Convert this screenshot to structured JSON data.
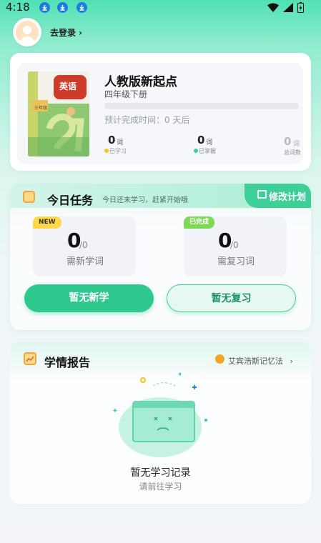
{
  "status_bar": {
    "time": "4:18"
  },
  "header": {
    "login_label": "去登录 ›"
  },
  "book": {
    "cover_text": "英语",
    "cover_grade": "三年级",
    "title": "人教版新起点",
    "grade": "四年级下册",
    "progress_fraction": 0,
    "eta": "预计完成时间：0 天后",
    "stats": [
      {
        "value": "0",
        "unit": "词",
        "label": "已学习",
        "color": "#f5c518"
      },
      {
        "value": "0",
        "unit": "词",
        "label": "已掌握",
        "color": "#3ccf98"
      },
      {
        "value": "0",
        "unit": "词",
        "label": "总词数",
        "color": ""
      }
    ]
  },
  "task": {
    "title": "今日任务",
    "subtitle": "今日还未学习，赶紧开始哦",
    "plan_label": "修改计划",
    "new_tag": "NEW",
    "new_count": "0",
    "new_total": "/0",
    "new_label": "需新学词",
    "done_tag": "已完成",
    "review_count": "0",
    "review_total": "/0",
    "review_label": "需复习词",
    "new_button": "暂无新学",
    "review_button": "暂无复习"
  },
  "report": {
    "title": "学情报告",
    "memory_link": "艾宾浩斯记忆法",
    "empty_title": "暂无学习记录",
    "empty_sub": "请前往学习"
  },
  "colors": {
    "accent": "#3ccf98",
    "accent_dark": "#2fc98f",
    "tag_yellow": "#f5c518"
  }
}
